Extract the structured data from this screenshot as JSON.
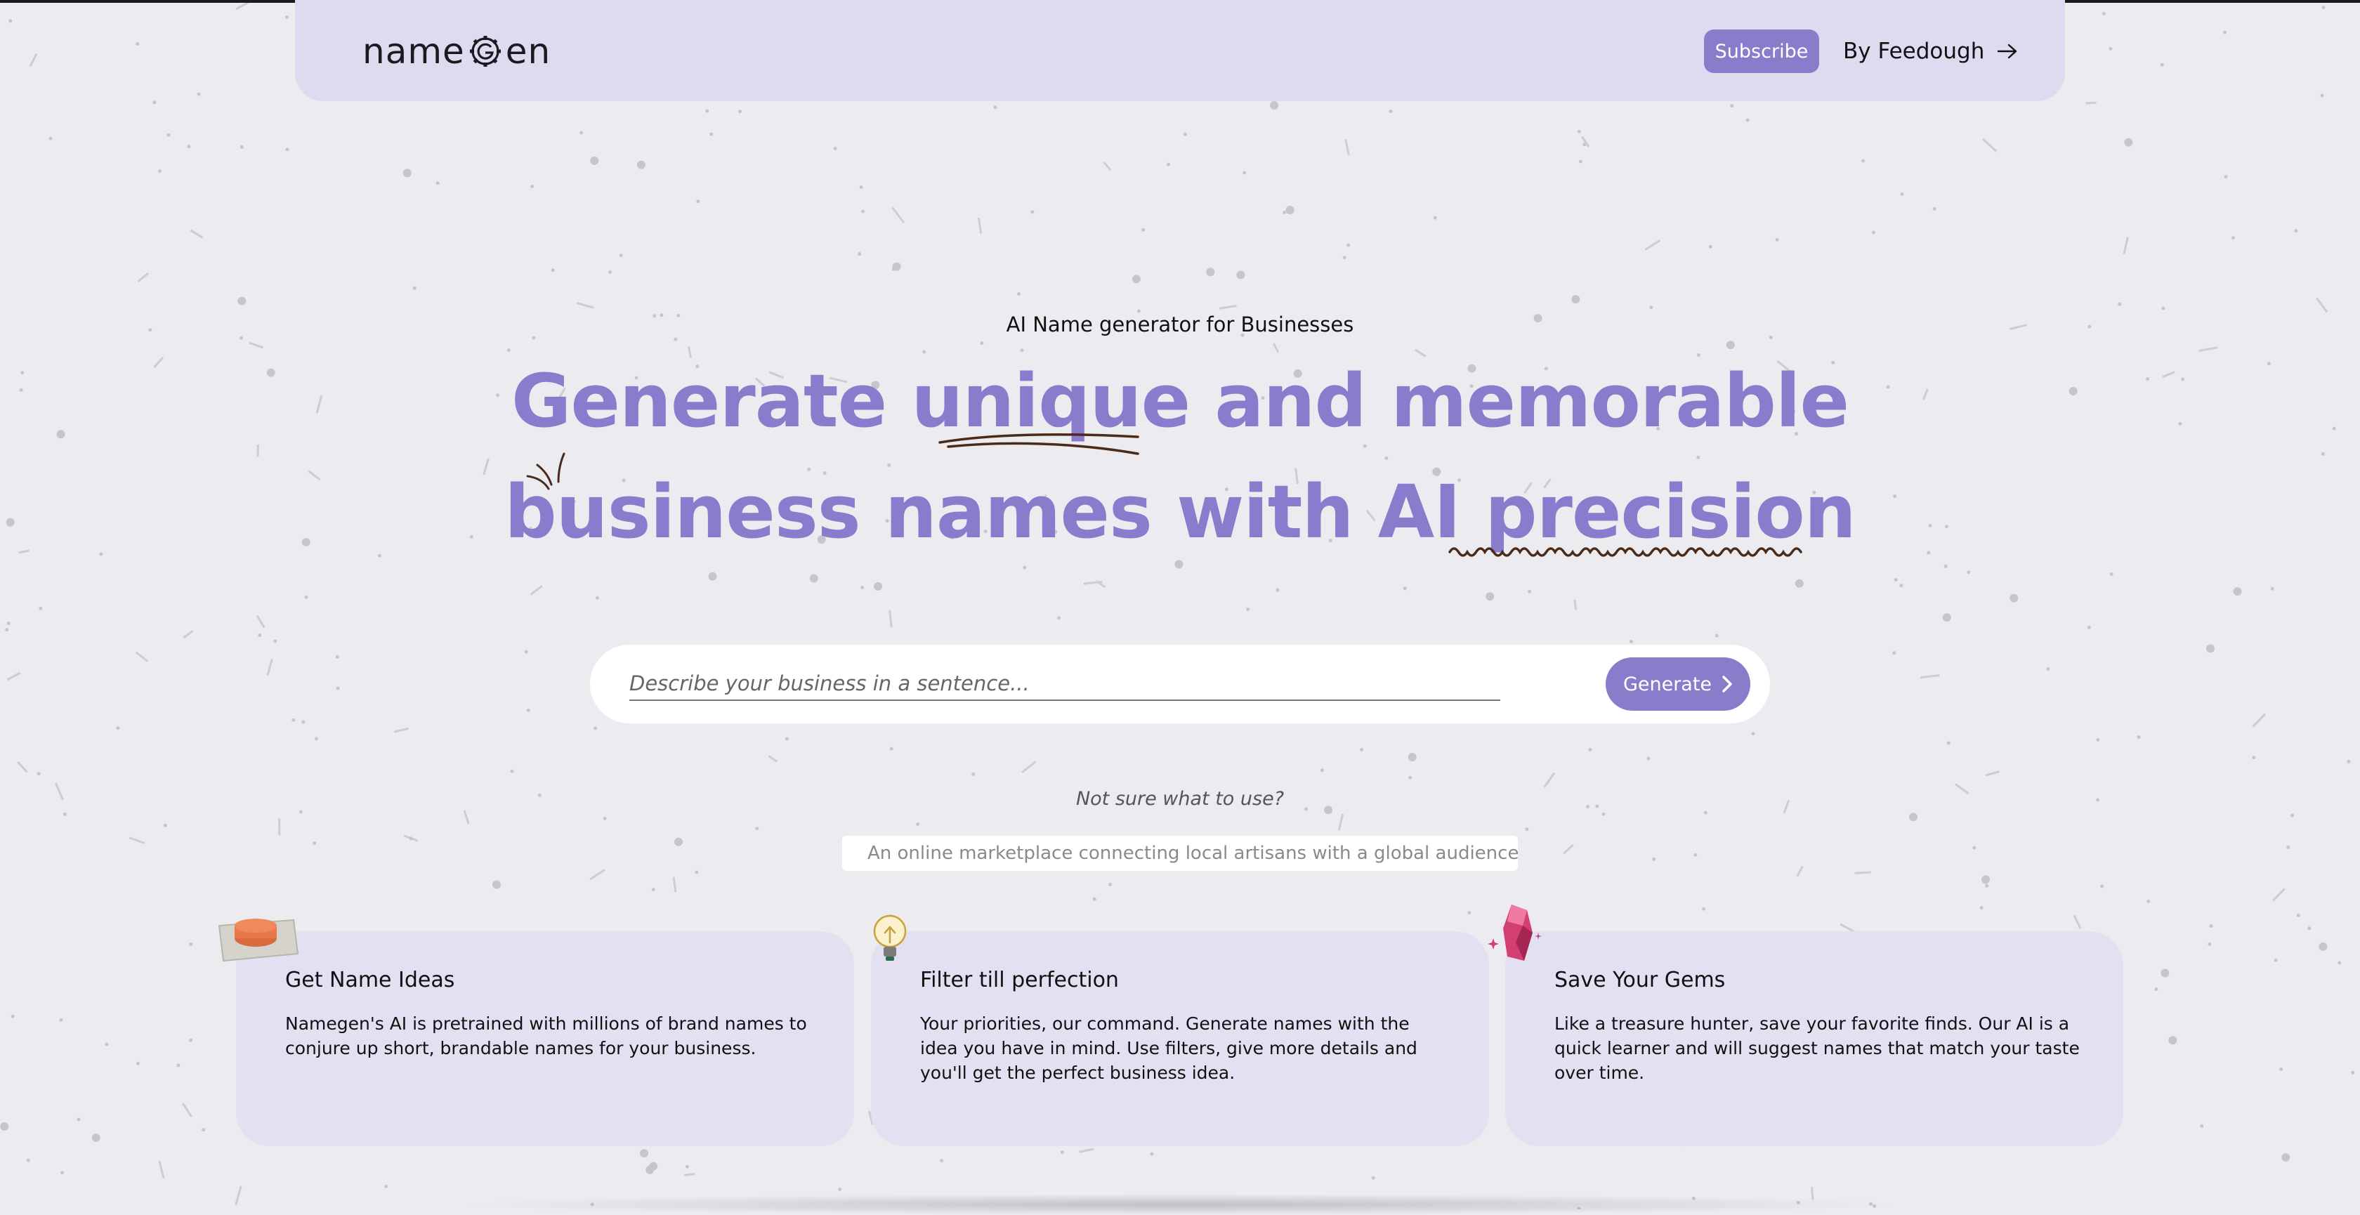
{
  "header": {
    "logo_prefix": "name",
    "logo_suffix": "en",
    "subscribe_label": "Subscribe",
    "by_label": "By Feedough"
  },
  "hero": {
    "eyebrow": "AI Name generator for Businesses",
    "headline_line1": "Generate unique and memorable",
    "headline_line2": "business names with AI precision"
  },
  "search": {
    "placeholder": "Describe your business in a sentence...",
    "value": "",
    "button_label": "Generate"
  },
  "suggestions": {
    "prompt": "Not sure what to use?",
    "example": "An online marketplace connecting local artisans with a global audience"
  },
  "cards": [
    {
      "title": "Get Name Ideas",
      "body": "Namegen's AI is pretrained with millions of brand names to conjure up short, brandable names for your business.",
      "icon": "button-icon"
    },
    {
      "title": "Filter till perfection",
      "body": "Your priorities, our command. Generate names with the idea you have in mind. Use filters, give more details and you'll get the perfect business idea.",
      "icon": "lightbulb-icon"
    },
    {
      "title": "Save Your Gems",
      "body": "Like a treasure hunter, save your favorite finds. Our AI is a quick learner and will suggest names that match your taste over time.",
      "icon": "gem-icon"
    }
  ],
  "colors": {
    "accent": "#8b7bcb",
    "headline": "#8a7bcc",
    "header_bg": "#dedaf0",
    "card_bg": "#e3e1f1",
    "page_bg": "#ecebf0"
  }
}
